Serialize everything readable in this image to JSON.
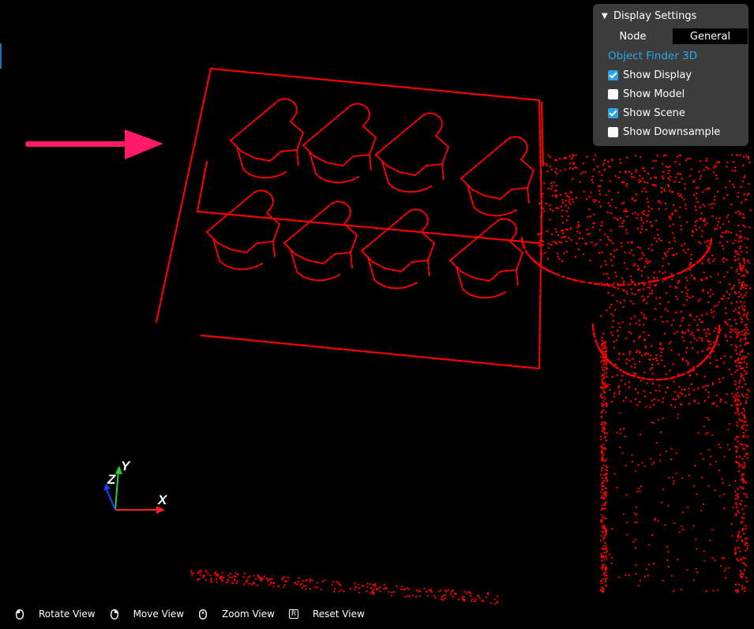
{
  "panel": {
    "title": "Display Settings",
    "node_label": "Node",
    "node_value": "General",
    "module": "Object Finder 3D",
    "options": [
      {
        "label": "Show Display",
        "checked": true
      },
      {
        "label": "Show Model",
        "checked": false
      },
      {
        "label": "Show Scene",
        "checked": true
      },
      {
        "label": "Show Downsample",
        "checked": false
      }
    ]
  },
  "axes": {
    "x": "X",
    "y": "Y",
    "z": "Z"
  },
  "toolbar": {
    "rotate": "Rotate View",
    "move": "Move View",
    "zoom": "Zoom View",
    "reset": "Reset View",
    "reset_key": "R"
  },
  "colors": {
    "points": "#ff0000",
    "arrow": "#ff1a6a",
    "panel_bg": "#3c3c3c",
    "accent": "#2aa3e6"
  }
}
